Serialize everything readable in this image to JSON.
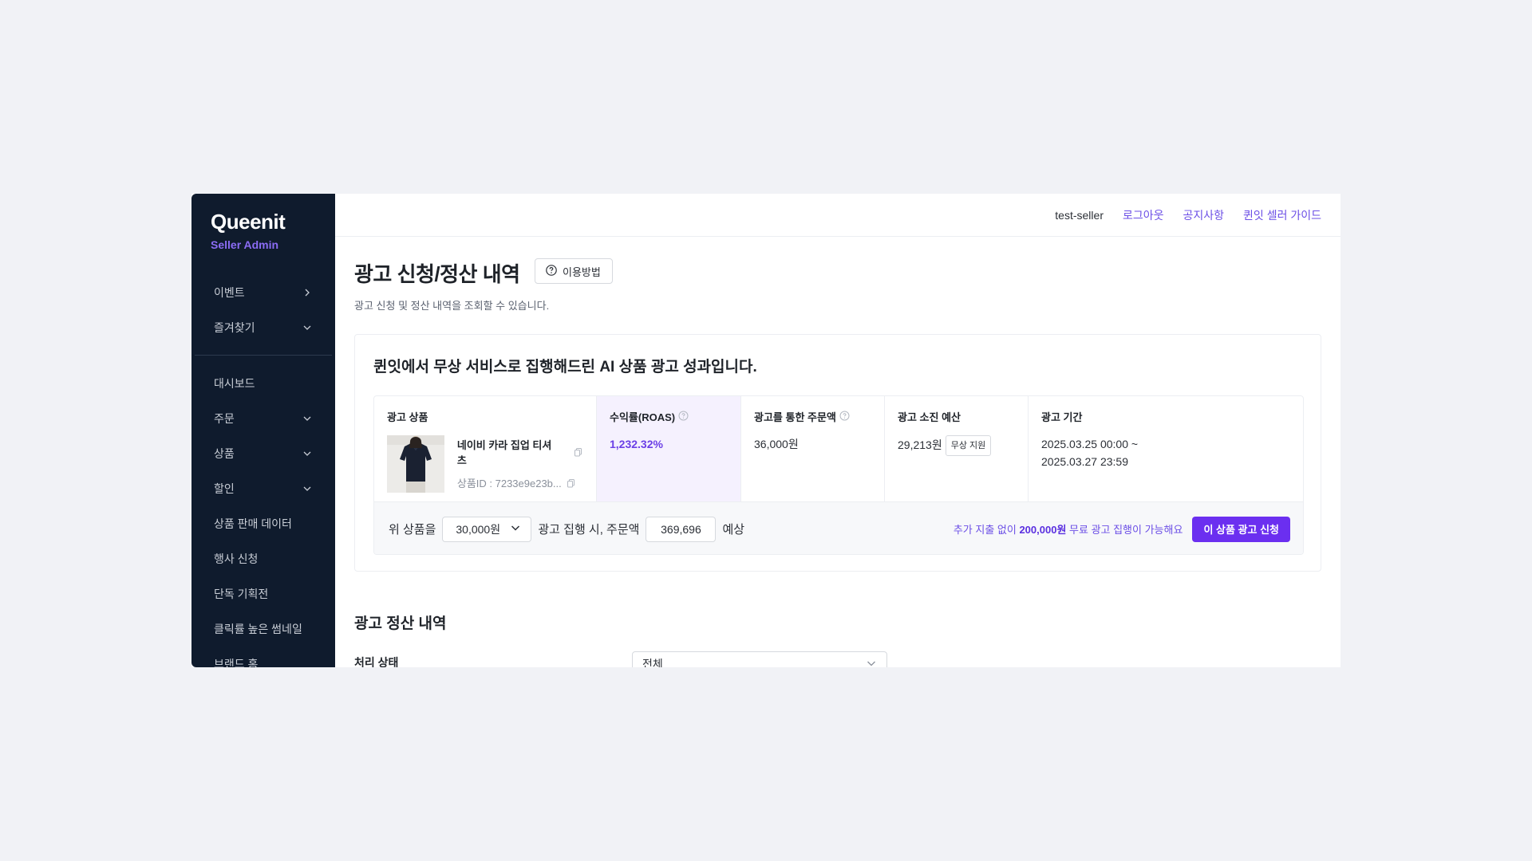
{
  "sidebar": {
    "brand": "Queenit",
    "subtitle": "Seller Admin",
    "items": [
      {
        "label": "이벤트",
        "chevron": "right"
      },
      {
        "label": "즐겨찾기",
        "chevron": "down"
      },
      {
        "label": "대시보드",
        "chevron": ""
      },
      {
        "label": "주문",
        "chevron": "down"
      },
      {
        "label": "상품",
        "chevron": "down"
      },
      {
        "label": "할인",
        "chevron": "down"
      },
      {
        "label": "상품 판매 데이터",
        "chevron": ""
      },
      {
        "label": "행사 신청",
        "chevron": ""
      },
      {
        "label": "단독 기획전",
        "chevron": ""
      },
      {
        "label": "클릭률 높은 썸네일",
        "chevron": ""
      },
      {
        "label": "브랜드 홈",
        "chevron": ""
      }
    ]
  },
  "header": {
    "user": "test-seller",
    "links": [
      "로그아웃",
      "공지사항",
      "퀸잇 셀러 가이드"
    ]
  },
  "page": {
    "title": "광고 신청/정산 내역",
    "help_label": "이용방법",
    "description": "광고 신청 및 정산 내역을 조회할 수 있습니다."
  },
  "performance": {
    "title": "퀸잇에서 무상 서비스로 집행해드린 AI 상품 광고 성과입니다.",
    "headers": {
      "product": "광고 상품",
      "roas": "수익률(ROAS)",
      "orders": "광고를 통한 주문액",
      "budget": "광고 소진 예산",
      "period": "광고 기간"
    },
    "product_name": "네이비 카라 집업 티셔츠",
    "product_id": "상품ID : 7233e9e23b...",
    "roas": "1,232.32%",
    "order_amount": "36,000원",
    "budget_spent": "29,213원",
    "budget_badge": "무상 지원",
    "period_start": "2025.03.25 00:00 ~",
    "period_end": "2025.03.27 23:59"
  },
  "simulation": {
    "prefix": "위 상품을",
    "budget_option": "30,000원",
    "middle": "광고 집행 시, 주문액",
    "estimate": "369,696",
    "suffix": "예상",
    "note_prefix": "추가 지출 없이",
    "note_amount": "200,000원",
    "note_suffix": "무료 광고 집행이 가능해요",
    "apply_label": "이 상품 광고 신청"
  },
  "settlement": {
    "title": "광고 정산 내역",
    "status_label": "처리 상태",
    "status_value": "전체"
  },
  "colors": {
    "sidebar_bg": "#0f1b2d",
    "accent": "#6b2ff0",
    "roas_bg": "#f5f1fe"
  }
}
